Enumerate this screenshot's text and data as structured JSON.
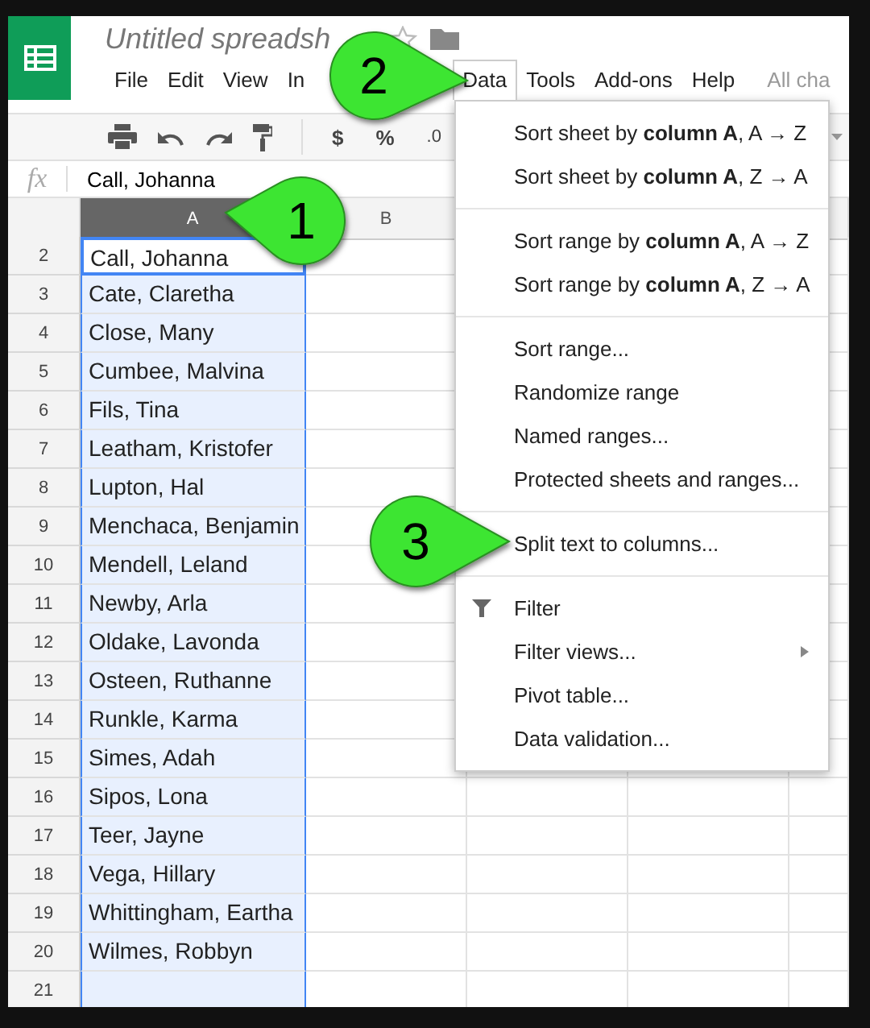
{
  "app": {
    "title": "Untitled spreadsh"
  },
  "menubar": [
    {
      "label": "File",
      "selected": false
    },
    {
      "label": "Edit",
      "selected": false
    },
    {
      "label": "View",
      "selected": false
    },
    {
      "label": "In",
      "selected": false
    },
    {
      "label": "Data",
      "selected": true
    },
    {
      "label": "Tools",
      "selected": false
    },
    {
      "label": "Add-ons",
      "selected": false
    },
    {
      "label": "Help",
      "selected": false
    }
  ],
  "save_status": "All cha",
  "toolbar": {
    "currency": "$",
    "percent": "%",
    "decimal": ".0"
  },
  "formula_bar": {
    "label": "fx",
    "value": "Call, Johanna"
  },
  "columns": [
    {
      "label": "A",
      "selected": true
    },
    {
      "label": "B",
      "selected": false
    }
  ],
  "rows": [
    {
      "number": "2",
      "value": "Call, Johanna",
      "active": true
    },
    {
      "number": "3",
      "value": "Cate, Claretha",
      "active": false
    },
    {
      "number": "4",
      "value": "Close, Many",
      "active": false
    },
    {
      "number": "5",
      "value": "Cumbee, Malvina",
      "active": false
    },
    {
      "number": "6",
      "value": "Fils, Tina",
      "active": false
    },
    {
      "number": "7",
      "value": "Leatham, Kristofer",
      "active": false
    },
    {
      "number": "8",
      "value": "Lupton, Hal",
      "active": false
    },
    {
      "number": "9",
      "value": "Menchaca, Benjamin",
      "active": false
    },
    {
      "number": "10",
      "value": "Mendell, Leland",
      "active": false
    },
    {
      "number": "11",
      "value": "Newby, Arla",
      "active": false
    },
    {
      "number": "12",
      "value": "Oldake, Lavonda",
      "active": false
    },
    {
      "number": "13",
      "value": "Osteen, Ruthanne",
      "active": false
    },
    {
      "number": "14",
      "value": "Runkle, Karma",
      "active": false
    },
    {
      "number": "15",
      "value": "Simes, Adah",
      "active": false
    },
    {
      "number": "16",
      "value": "Sipos, Lona",
      "active": false
    },
    {
      "number": "17",
      "value": "Teer, Jayne",
      "active": false
    },
    {
      "number": "18",
      "value": "Vega, Hillary",
      "active": false
    },
    {
      "number": "19",
      "value": "Whittingham, Eartha",
      "active": false
    },
    {
      "number": "20",
      "value": "Wilmes, Robbyn",
      "active": false
    },
    {
      "number": "21",
      "value": "",
      "active": false
    }
  ],
  "data_menu": [
    [
      {
        "label": "Sort sheet by **column A**, A → Z",
        "icon": false,
        "submenu": false
      },
      {
        "label": "Sort sheet by **column A**, Z → A",
        "icon": false,
        "submenu": false
      }
    ],
    [
      {
        "label": "Sort range by **column A**, A → Z",
        "icon": false,
        "submenu": false
      },
      {
        "label": "Sort range by **column A**, Z → A",
        "icon": false,
        "submenu": false
      }
    ],
    [
      {
        "label": "Sort range...",
        "icon": false,
        "submenu": false
      },
      {
        "label": "Randomize range",
        "icon": false,
        "submenu": false
      },
      {
        "label": "Named ranges...",
        "icon": false,
        "submenu": false
      },
      {
        "label": "Protected sheets and ranges...",
        "icon": false,
        "submenu": false
      }
    ],
    [
      {
        "label": "Split text to columns...",
        "icon": false,
        "submenu": false
      }
    ],
    [
      {
        "label": "Filter",
        "icon": true,
        "submenu": false
      },
      {
        "label": "Filter views...",
        "icon": false,
        "submenu": true
      },
      {
        "label": "Pivot table...",
        "icon": false,
        "submenu": false
      },
      {
        "label": "Data validation...",
        "icon": false,
        "submenu": false
      }
    ]
  ],
  "callouts": [
    {
      "label": "1"
    },
    {
      "label": "2"
    },
    {
      "label": "3"
    }
  ]
}
